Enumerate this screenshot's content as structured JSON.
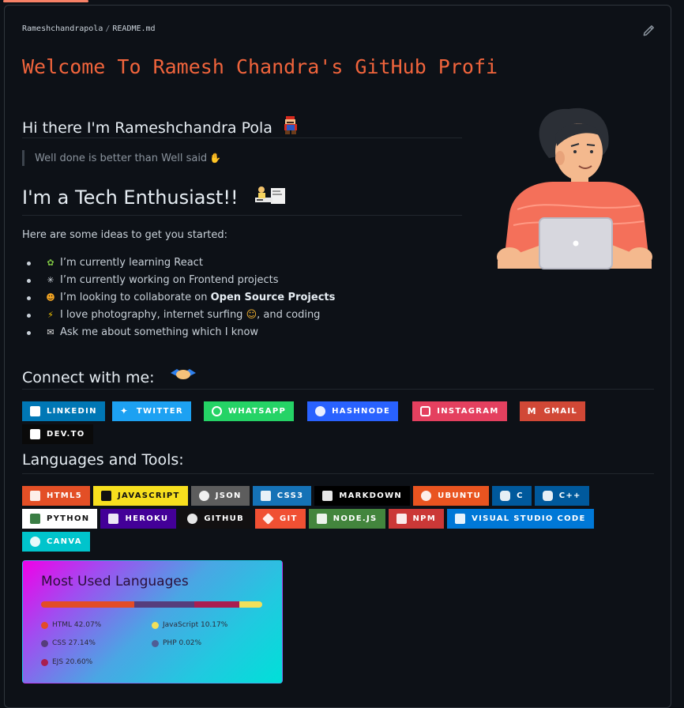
{
  "breadcrumb": {
    "owner": "Rameshchandrapola",
    "separator": "/",
    "file": "README.md"
  },
  "heading_main": "Welcome To Ramesh Chandra's GitHub Profi",
  "greeting": "Hi there I'm Rameshchandra Pola",
  "quote": "Well done is better than Well said",
  "tech_heading": "I'm a Tech Enthusiast!!",
  "ideas_intro": "Here are some ideas to get you started:",
  "ideas": [
    {
      "icon": "seedling",
      "text": "I’m currently learning React"
    },
    {
      "icon": "telescope",
      "text": "I’m currently working on Frontend projects"
    },
    {
      "icon": "people",
      "text_before": "I’m looking to collaborate on ",
      "strong": "Open Source Projects"
    },
    {
      "icon": "lightning",
      "text_before": "I love photography, internet surfing ",
      "text_after": ", and coding"
    },
    {
      "icon": "speech",
      "text": "Ask me about something which I know"
    }
  ],
  "connect_heading": "Connect with me:",
  "connect_badges": [
    {
      "label": "LINKEDIN",
      "color": "#0077b5",
      "icon": "linkedin"
    },
    {
      "label": "TWITTER",
      "color": "#1da1f2",
      "icon": "twitter"
    },
    {
      "label": "WHATSAPP",
      "color": "#25d366",
      "icon": "whatsapp"
    },
    {
      "label": "HASHNODE",
      "color": "#2962ff",
      "icon": "hashnode"
    },
    {
      "label": "INSTAGRAM",
      "color": "#e4405f",
      "icon": "instagram"
    },
    {
      "label": "GMAIL",
      "color": "#d14836",
      "icon": "gmail"
    },
    {
      "label": "DEV.TO",
      "color": "#0a0a0a",
      "icon": "devto"
    }
  ],
  "tools_heading": "Languages and Tools:",
  "tool_badges": [
    {
      "label": "HTML5",
      "color": "#e34f26",
      "text_color": "#ffffff",
      "icon": "html5"
    },
    {
      "label": "JAVASCRIPT",
      "color": "#f7df1e",
      "text_color": "#111111",
      "icon": "javascript"
    },
    {
      "label": "JSON",
      "color": "#5d5d5d",
      "text_color": "#ffffff",
      "icon": "json"
    },
    {
      "label": "CSS3",
      "color": "#1572b6",
      "text_color": "#ffffff",
      "icon": "css3"
    },
    {
      "label": "MARKDOWN",
      "color": "#000000",
      "text_color": "#ffffff",
      "icon": "markdown"
    },
    {
      "label": "UBUNTU",
      "color": "#e95420",
      "text_color": "#ffffff",
      "icon": "ubuntu"
    },
    {
      "label": "C",
      "color": "#00599c",
      "text_color": "#ffffff",
      "icon": "c"
    },
    {
      "label": "C++",
      "color": "#00599c",
      "text_color": "#ffffff",
      "icon": "cplusplus"
    },
    {
      "label": "PYTHON",
      "color": "#ffffff",
      "text_color": "#111111",
      "icon": "python"
    },
    {
      "label": "HEROKU",
      "color": "#430098",
      "text_color": "#ffffff",
      "icon": "heroku"
    },
    {
      "label": "GITHUB",
      "color": "#121011",
      "text_color": "#ffffff",
      "icon": "github"
    },
    {
      "label": "GIT",
      "color": "#f05033",
      "text_color": "#ffffff",
      "icon": "git"
    },
    {
      "label": "NODE.JS",
      "color": "#43853d",
      "text_color": "#ffffff",
      "icon": "nodejs"
    },
    {
      "label": "NPM",
      "color": "#cb3837",
      "text_color": "#ffffff",
      "icon": "npm"
    },
    {
      "label": "VISUAL STUDIO CODE",
      "color": "#0078d7",
      "text_color": "#ffffff",
      "icon": "vscode"
    },
    {
      "label": "CANVA",
      "color": "#00c4cc",
      "text_color": "#ffffff",
      "icon": "canva"
    }
  ],
  "languages_card": {
    "title": "Most Used Languages",
    "languages": [
      {
        "name": "HTML",
        "percent": 42.07,
        "label": "HTML 42.07%",
        "color": "#e34c26"
      },
      {
        "name": "CSS",
        "percent": 27.14,
        "label": "CSS 27.14%",
        "color": "#563d7c"
      },
      {
        "name": "EJS",
        "percent": 20.6,
        "label": "EJS 20.60%",
        "color": "#a91e50"
      },
      {
        "name": "JavaScript",
        "percent": 10.17,
        "label": "JavaScript 10.17%",
        "color": "#f1e05a"
      },
      {
        "name": "PHP",
        "percent": 0.02,
        "label": "PHP 0.02%",
        "color": "#4f5d95"
      }
    ]
  }
}
